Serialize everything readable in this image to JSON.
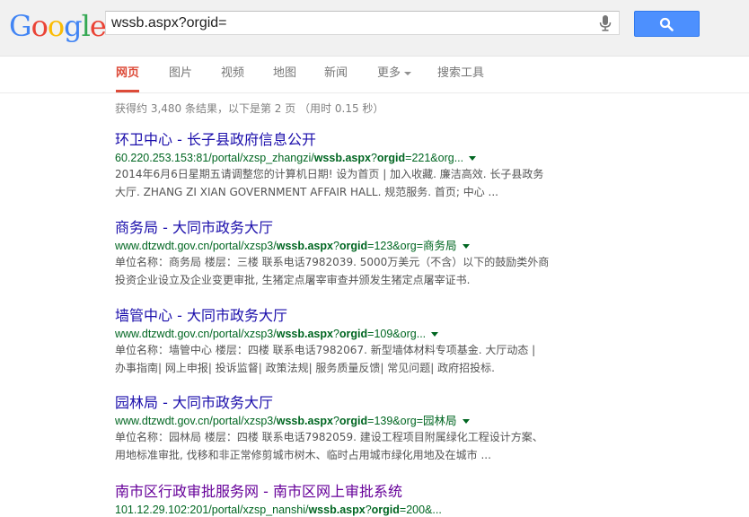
{
  "logo": {
    "letters": [
      "G",
      "o",
      "o",
      "g",
      "l",
      "e"
    ],
    "colors": [
      "#4285f4",
      "#ea4335",
      "#fbbc05",
      "#4285f4",
      "#34a853",
      "#ea4335"
    ]
  },
  "search": {
    "query": "wssb.aspx?orgid=",
    "button_icon": "search-icon",
    "mic_icon": "mic-icon"
  },
  "tabs": [
    {
      "label": "网页",
      "active": true
    },
    {
      "label": "图片"
    },
    {
      "label": "视频"
    },
    {
      "label": "地图"
    },
    {
      "label": "新闻"
    },
    {
      "label": "更多"
    },
    {
      "label": "搜索工具"
    }
  ],
  "stats": "获得约 3,480 条结果，以下是第 2 页 （用时 0.15 秒）",
  "results": [
    {
      "title": "环卫中心 - 长子县政府信息公开",
      "url_pre": "60.220.253.153:81/portal/xzsp_zhangzi/",
      "url_bold1": "wssb.aspx",
      "url_mid": "?",
      "url_bold2": "orgid",
      "url_post": "=221&org...",
      "snippet1": "2014年6月6日星期五请调整您的计算机日期! 设为首页 | 加入收藏. 廉洁高效. 长子县政务",
      "snippet2": "大厅. ZHANG ZI XIAN GOVERNMENT AFFAIR HALL. 规范服务. 首页; 中心 ..."
    },
    {
      "title": "商务局 - 大同市政务大厅",
      "url_pre": "www.dtzwdt.gov.cn/portal/xzsp3/",
      "url_bold1": "wssb.aspx",
      "url_mid": "?",
      "url_bold2": "orgid",
      "url_post": "=123&org=商务局",
      "snippet1": "单位名称：商务局 楼层：三楼 联系电话7982039. 5000万美元（不含）以下的鼓励类外商",
      "snippet2": "投资企业设立及企业变更审批, 生猪定点屠宰审查并颁发生猪定点屠宰证书."
    },
    {
      "title": "墙管中心 - 大同市政务大厅",
      "url_pre": "www.dtzwdt.gov.cn/portal/xzsp3/",
      "url_bold1": "wssb.aspx",
      "url_mid": "?",
      "url_bold2": "orgid",
      "url_post": "=109&org...",
      "snippet1": "单位名称：墙管中心 楼层：四楼 联系电话7982067. 新型墙体材料专项基金. 大厅动态 |",
      "snippet2": "办事指南| 网上申报| 投诉监督| 政策法规| 服务质量反馈| 常见问题| 政府招投标."
    },
    {
      "title": "园林局 - 大同市政务大厅",
      "url_pre": "www.dtzwdt.gov.cn/portal/xzsp3/",
      "url_bold1": "wssb.aspx",
      "url_mid": "?",
      "url_bold2": "orgid",
      "url_post": "=139&org=园林局",
      "snippet1": "单位名称：园林局 楼层：四楼 联系电话7982059. 建设工程项目附属绿化工程设计方案、",
      "snippet2": "用地标准审批, 伐移和非正常修剪城市树木、临时占用城市绿化用地及在城市 ..."
    },
    {
      "title": "南市区行政审批服务网 - 南市区网上审批系统",
      "url_pre": "101.12.29.102:201/portal/xzsp_nanshi/",
      "url_bold1": "wssb.aspx",
      "url_mid": "?",
      "url_bold2": "orgid",
      "url_post": "=200&...",
      "snippet1": "",
      "snippet2": ""
    }
  ]
}
